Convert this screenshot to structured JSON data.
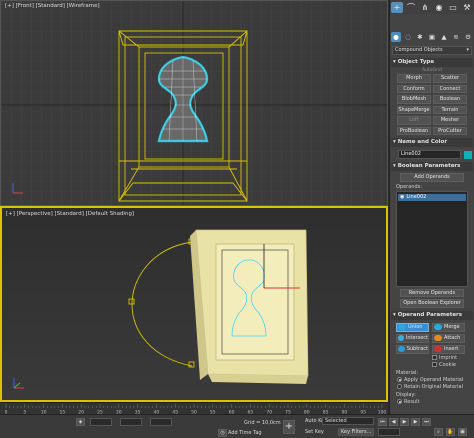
{
  "viewports": {
    "front_label": "[+] [Front] [Standard] [Wireframe]",
    "perspective_label": "[+] [Perspective] [Standard] [Default Shading]"
  },
  "command_panel": {
    "tabs": [
      "plus-icon",
      "curve-icon",
      "hierarchy-icon",
      "motion-icon",
      "display-icon",
      "utilities-icon"
    ],
    "create_icons": [
      "geometry-icon",
      "shapes-icon",
      "lights-icon",
      "cameras-icon",
      "helpers-icon",
      "spacewarps-icon",
      "systems-icon"
    ],
    "category_dropdown": "Compound Objects",
    "object_type_title": "Object Type",
    "autogrid_label": "AutoGrid",
    "object_buttons": [
      "Morph",
      "Scatter",
      "Conform",
      "Connect",
      "BlobMesh",
      "Boolean",
      "ShapeMerge",
      "Terrain",
      "Loft",
      "Mesher",
      "ProBoolean",
      "ProCutter"
    ],
    "name_color_title": "Name and Color",
    "object_name": "Line002",
    "object_color": "#14b0b8",
    "boolean_params_title": "Boolean Parameters",
    "add_operands_label": "Add Operands",
    "operands_label": "Operands:",
    "operand_item": "Line002",
    "remove_operands_label": "Remove Operands",
    "open_explorer_label": "Open Boolean Explorer",
    "operand_params_title": "Operand Parameters",
    "operations": [
      {
        "label": "Union",
        "color": "#2aa8e0"
      },
      {
        "label": "Merge",
        "color": "#2aa8e0"
      },
      {
        "label": "Intersect",
        "color": "#3ab0e0"
      },
      {
        "label": "Attach",
        "color": "#e08a20"
      },
      {
        "label": "Subtract",
        "color": "#2a9ad8"
      },
      {
        "label": "Insert",
        "color": "#d03030"
      }
    ],
    "imprint_label": "Imprint",
    "cookie_label": "Cookie",
    "material_label": "Material:",
    "material_opt1": "Apply Operand Material",
    "material_opt2": "Retain Original Material",
    "display_label": "Display:",
    "display_opt": "Result"
  },
  "timeline": {
    "ticks": [
      "0",
      "5",
      "10",
      "15",
      "20",
      "25",
      "30",
      "35",
      "40",
      "45",
      "50",
      "55",
      "60",
      "65",
      "70",
      "75",
      "80",
      "85",
      "90",
      "95",
      "100"
    ]
  },
  "status_bar": {
    "grid_label": "Grid = 10,0cm",
    "add_time_tag": "Add Time Tag",
    "auto_key": "Auto Key",
    "set_key": "Set Key",
    "selected_value": "Selected",
    "key_filters": "Key Filters..."
  }
}
